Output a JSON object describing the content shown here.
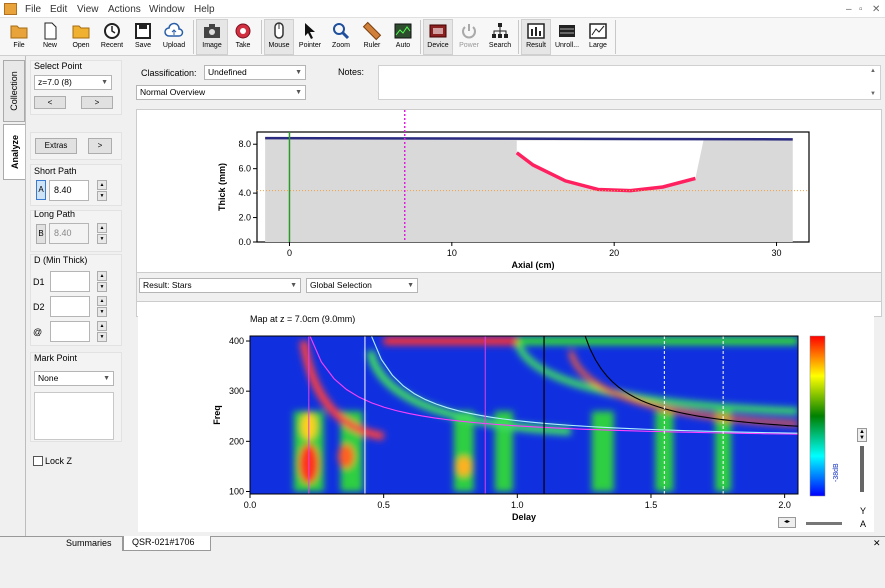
{
  "menu": [
    "File",
    "Edit",
    "View",
    "Actions",
    "Window",
    "Help"
  ],
  "window_controls": {
    "minimize": "–",
    "restore": "▫",
    "close": "✕"
  },
  "toolbar": [
    {
      "name": "file",
      "label": "File"
    },
    {
      "name": "new",
      "label": "New"
    },
    {
      "name": "open",
      "label": "Open"
    },
    {
      "name": "recent",
      "label": "Recent"
    },
    {
      "name": "save",
      "label": "Save"
    },
    {
      "name": "upload",
      "label": "Upload"
    },
    {
      "name": "image",
      "label": "Image"
    },
    {
      "name": "take",
      "label": "Take"
    },
    {
      "name": "mouse",
      "label": "Mouse"
    },
    {
      "name": "pointer",
      "label": "Pointer"
    },
    {
      "name": "zoom",
      "label": "Zoom"
    },
    {
      "name": "ruler",
      "label": "Ruler"
    },
    {
      "name": "auto",
      "label": "Auto"
    },
    {
      "name": "device",
      "label": "Device"
    },
    {
      "name": "power",
      "label": "Power"
    },
    {
      "name": "search",
      "label": "Search"
    },
    {
      "name": "result",
      "label": "Result"
    },
    {
      "name": "unroll",
      "label": "Unroll..."
    },
    {
      "name": "large",
      "label": "Large"
    }
  ],
  "side_tabs": {
    "collection": "Collection",
    "analyze": "Analyze"
  },
  "left": {
    "select_point_label": "Select Point",
    "select_point_value": "z=7.0 (8)",
    "prev": "<",
    "next": ">",
    "extras": "Extras",
    "extras_arrow": ">",
    "short_path_label": "Short Path",
    "short_path_letter": "A",
    "short_path_value": "8.40",
    "long_path_label": "Long Path",
    "long_path_letter": "B",
    "long_path_value": "8.40",
    "min_thick_label": "D (Min Thick)",
    "d1": "D1",
    "d2": "D2",
    "at": "@",
    "mark_point_label": "Mark Point",
    "mark_point_value": "None",
    "lock_z": "Lock Z"
  },
  "top": {
    "classification_label": "Classification:",
    "classification_value": "Undefined",
    "overview_value": "Normal Overview",
    "notes_label": "Notes:"
  },
  "result": {
    "result_value": "Result: Stars",
    "selection_value": "Global Selection"
  },
  "colorbar": {
    "label": "-38dB"
  },
  "bottom_right": {
    "y": "Y",
    "a": "A"
  },
  "tabs": {
    "summaries": "Summaries",
    "file": "QSR-021#1706",
    "close": "✕"
  },
  "chart_data": [
    {
      "type": "area",
      "xlabel": "Axial (cm)",
      "ylabel": "Thick (mm)",
      "xlim": [
        -2,
        32
      ],
      "ylim": [
        0,
        9
      ],
      "xticks": [
        0,
        10,
        20,
        30
      ],
      "yticks": [
        0.0,
        2.0,
        4.0,
        6.0,
        8.0
      ],
      "series": [
        {
          "values": [
            [
              -1.5,
              8.5
            ],
            [
              31,
              8.4
            ]
          ]
        },
        {
          "values": [
            [
              14,
              7.3
            ],
            [
              15,
              6.3
            ],
            [
              17,
              5.0
            ],
            [
              19,
              4.3
            ],
            [
              21,
              4.2
            ],
            [
              23,
              4.5
            ],
            [
              25,
              5.2
            ]
          ]
        }
      ],
      "annotations": {
        "green_line_x": 0,
        "magenta_dashed_x": 7.1,
        "orange_dotted_y": 4.2
      }
    },
    {
      "type": "heatmap",
      "title": "Map at z = 7.0cm (9.0mm)",
      "xlabel": "Delay",
      "ylabel": "Freq",
      "xlim": [
        0,
        2.05
      ],
      "ylim": [
        95,
        410
      ],
      "xticks": [
        0.0,
        0.5,
        1.0,
        1.5,
        2.0
      ],
      "yticks": [
        100,
        200,
        300,
        400
      ],
      "vertical_lines": {
        "white": [
          0.43,
          1.55,
          1.77
        ],
        "magenta": [
          0.22,
          0.88
        ],
        "black": [
          1.1
        ]
      },
      "colorscale": [
        "red",
        "yellow",
        "green",
        "cyan",
        "blue"
      ]
    }
  ]
}
